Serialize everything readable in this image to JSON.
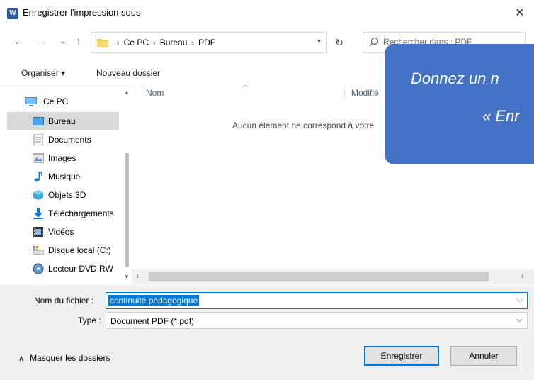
{
  "window": {
    "title": "Enregistrer l'impression sous",
    "app_icon_text": "W"
  },
  "nav": {
    "breadcrumb": [
      "Ce PC",
      "Bureau",
      "PDF"
    ],
    "search_placeholder": "Rechercher dans : PDF"
  },
  "toolbar": {
    "organize": "Organiser ▾",
    "new_folder": "Nouveau dossier"
  },
  "sidebar": {
    "items": [
      {
        "label": "Ce PC",
        "icon": "pc-icon"
      },
      {
        "label": "Bureau",
        "icon": "desktop-folder-icon",
        "selected": true
      },
      {
        "label": "Documents",
        "icon": "documents-icon"
      },
      {
        "label": "Images",
        "icon": "images-icon"
      },
      {
        "label": "Musique",
        "icon": "music-icon"
      },
      {
        "label": "Objets 3D",
        "icon": "3d-objects-icon"
      },
      {
        "label": "Téléchargements",
        "icon": "downloads-icon"
      },
      {
        "label": "Vidéos",
        "icon": "videos-icon"
      },
      {
        "label": "Disque local (C:)",
        "icon": "drive-icon"
      },
      {
        "label": "Lecteur DVD RW",
        "icon": "dvd-icon"
      }
    ]
  },
  "filelist": {
    "columns": {
      "name": "Nom",
      "modified": "Modifié"
    },
    "empty_message": "Aucun élément ne correspond à votre"
  },
  "form": {
    "filename_label": "Nom du fichier :",
    "filename_value": "continuité pédagogique",
    "type_label": "Type :",
    "type_value": "Document PDF (*.pdf)"
  },
  "footer": {
    "hide_folders": "Masquer les dossiers",
    "save": "Enregistrer",
    "cancel": "Annuler"
  },
  "callout": {
    "line1": "Donnez un n",
    "line2": "« Enr"
  },
  "colors": {
    "accent": "#0078d7",
    "callout": "#4472c4",
    "selected": "#d9d9d9"
  }
}
